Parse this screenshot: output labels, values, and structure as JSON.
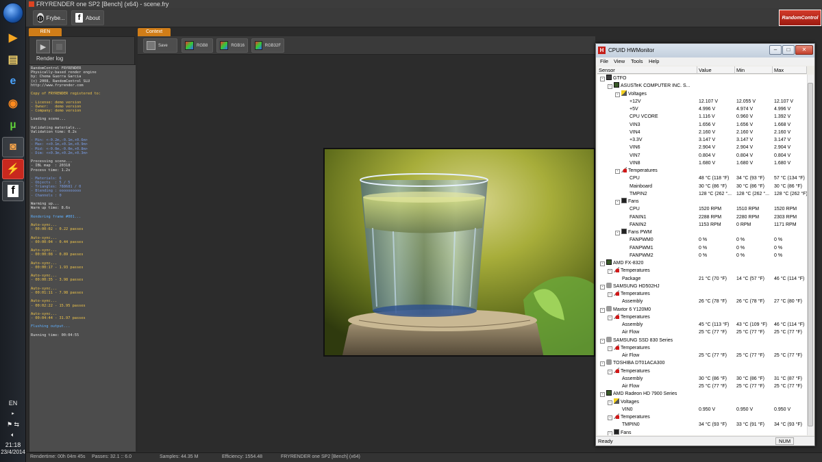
{
  "taskbar": {
    "language": "EN",
    "time": "21:18",
    "date": "23/4/2014"
  },
  "app": {
    "title": "FRYRENDER one SP2 [Bench] (x64) - scene.fry",
    "frybe_label": "Frybe...",
    "about_label": "About",
    "logo_text": "RandomControl",
    "ren_tab": "REN",
    "context_tab": "Context",
    "render_log_label": "Render log",
    "ctx_buttons": {
      "save": "Save",
      "rgb8": "RGB8",
      "rgb16": "RGB16",
      "rgb32f": "RGB32F"
    }
  },
  "log": [
    {
      "c": "lw",
      "t": "RandomControl FRYRENDER"
    },
    {
      "c": "lw",
      "t": "Physically-based render engine"
    },
    {
      "c": "lw",
      "t": "by: Chema Guerra Garcia"
    },
    {
      "c": "lw",
      "t": "(c) 2008, RandomControl SLU"
    },
    {
      "c": "lw",
      "t": "http://www.fryrender.com"
    },
    {
      "c": "lw",
      "t": ""
    },
    {
      "c": "ly",
      "t": "Copy of FRYRENDER registered to:"
    },
    {
      "c": "lw",
      "t": ""
    },
    {
      "c": "ly",
      "t": "- License: demo version"
    },
    {
      "c": "ly",
      "t": "- Owner:   demo version"
    },
    {
      "c": "ly",
      "t": "- Company: demo version"
    },
    {
      "c": "lw",
      "t": ""
    },
    {
      "c": "lw",
      "t": "Loading scene..."
    },
    {
      "c": "lw",
      "t": ""
    },
    {
      "c": "lw",
      "t": "Validating materials..."
    },
    {
      "c": "lw",
      "t": "Validation time: 0.2s"
    },
    {
      "c": "lw",
      "t": ""
    },
    {
      "c": "lb",
      "t": "- Min: <-0.2m,-0.1m,+0.6m>"
    },
    {
      "c": "lb",
      "t": "- Max: <+0.1m,+0.1m,+0.9m>"
    },
    {
      "c": "lb",
      "t": "- Mid: <-0.0m,-0.0m,+0.8m>"
    },
    {
      "c": "lb",
      "t": "- Dim: <+0.3m,+0.2m,+0.3m>"
    },
    {
      "c": "lw",
      "t": ""
    },
    {
      "c": "lw",
      "t": "Processing scene..."
    },
    {
      "c": "lw",
      "t": "- IBL map  : 20318"
    },
    {
      "c": "lw",
      "t": "Process time: 1.2s"
    },
    {
      "c": "lw",
      "t": ""
    },
    {
      "c": "lb",
      "t": "- Materials: 6"
    },
    {
      "c": "lb",
      "t": "- Objects  : 5 / 5"
    },
    {
      "c": "lb",
      "t": "- Triangles: 788681 / 0"
    },
    {
      "c": "lb",
      "t": "- Blending : oooooooooo"
    },
    {
      "c": "lb",
      "t": "- Channels : 0"
    },
    {
      "c": "lw",
      "t": ""
    },
    {
      "c": "lw",
      "t": "Warming up..."
    },
    {
      "c": "lw",
      "t": "Warm up time: 8.6s"
    },
    {
      "c": "lw",
      "t": ""
    },
    {
      "c": "lc",
      "t": "Rendering frame #001..."
    },
    {
      "c": "lw",
      "t": ""
    },
    {
      "c": "ly",
      "t": "Auto-sync..."
    },
    {
      "c": "ly",
      "t": "- 00:00:02 - 0.22 passes"
    },
    {
      "c": "lw",
      "t": ""
    },
    {
      "c": "ly",
      "t": "Auto-sync..."
    },
    {
      "c": "ly",
      "t": "- 00:00:04 - 0.44 passes"
    },
    {
      "c": "lw",
      "t": ""
    },
    {
      "c": "ly",
      "t": "Auto-sync..."
    },
    {
      "c": "ly",
      "t": "- 00:00:08 - 0.89 passes"
    },
    {
      "c": "lw",
      "t": ""
    },
    {
      "c": "ly",
      "t": "Auto-sync..."
    },
    {
      "c": "ly",
      "t": "- 00:00:17 - 1.93 passes"
    },
    {
      "c": "lw",
      "t": ""
    },
    {
      "c": "ly",
      "t": "Auto-sync..."
    },
    {
      "c": "ly",
      "t": "- 00:00:35 - 3.98 passes"
    },
    {
      "c": "lw",
      "t": ""
    },
    {
      "c": "ly",
      "t": "Auto-sync..."
    },
    {
      "c": "ly",
      "t": "- 00:01:11 - 7.98 passes"
    },
    {
      "c": "lw",
      "t": ""
    },
    {
      "c": "ly",
      "t": "Auto-sync..."
    },
    {
      "c": "ly",
      "t": "- 00:02:22 - 15.95 passes"
    },
    {
      "c": "lw",
      "t": ""
    },
    {
      "c": "ly",
      "t": "Auto-sync..."
    },
    {
      "c": "ly",
      "t": "- 00:04:44 - 31.97 passes"
    },
    {
      "c": "lw",
      "t": ""
    },
    {
      "c": "lc",
      "t": "Flushing output..."
    },
    {
      "c": "lw",
      "t": ""
    },
    {
      "c": "lw",
      "t": "Running time: 00:04:55"
    }
  ],
  "status": {
    "rendertime": "Rendertime:  00h 04m 45s",
    "passes": "Passes:  32.1 :: 6.0",
    "samples": "Samples:  44.35 M",
    "efficiency": "Efficiency:  1554.48",
    "product": "FRYRENDER one SP2 [Bench] (x64)"
  },
  "hwm": {
    "title": "CPUID HWMonitor",
    "menu": [
      "File",
      "View",
      "Tools",
      "Help"
    ],
    "columns": [
      "Sensor",
      "Value",
      "Min",
      "Max"
    ],
    "status_ready": "Ready",
    "status_num": "NUM",
    "rows": [
      {
        "lvl": 0,
        "icon": "ti-pc",
        "exp": "-",
        "n": "GTFO",
        "v": "",
        "mi": "",
        "ma": ""
      },
      {
        "lvl": 1,
        "icon": "ti-chip",
        "exp": "-",
        "n": "ASUSTeK COMPUTER INC. S...",
        "v": "",
        "mi": "",
        "ma": ""
      },
      {
        "lvl": 2,
        "icon": "ti-volt",
        "exp": "-",
        "n": "Voltages",
        "v": "",
        "mi": "",
        "ma": ""
      },
      {
        "lvl": 3,
        "n": "+12V",
        "v": "12.107 V",
        "mi": "12.055 V",
        "ma": "12.107 V"
      },
      {
        "lvl": 3,
        "n": "+5V",
        "v": "4.996 V",
        "mi": "4.974 V",
        "ma": "4.996 V"
      },
      {
        "lvl": 3,
        "n": "CPU VCORE",
        "v": "1.116 V",
        "mi": "0.960 V",
        "ma": "1.392 V"
      },
      {
        "lvl": 3,
        "n": "VIN3",
        "v": "1.656 V",
        "mi": "1.656 V",
        "ma": "1.668 V"
      },
      {
        "lvl": 3,
        "n": "VIN4",
        "v": "2.160 V",
        "mi": "2.160 V",
        "ma": "2.160 V"
      },
      {
        "lvl": 3,
        "n": "+3.3V",
        "v": "3.147 V",
        "mi": "3.147 V",
        "ma": "3.147 V"
      },
      {
        "lvl": 3,
        "n": "VIN6",
        "v": "2.904 V",
        "mi": "2.904 V",
        "ma": "2.904 V"
      },
      {
        "lvl": 3,
        "n": "VIN7",
        "v": "0.804 V",
        "mi": "0.804 V",
        "ma": "0.804 V"
      },
      {
        "lvl": 3,
        "n": "VIN8",
        "v": "1.680 V",
        "mi": "1.680 V",
        "ma": "1.680 V"
      },
      {
        "lvl": 2,
        "icon": "ti-temp",
        "exp": "-",
        "n": "Temperatures",
        "v": "",
        "mi": "",
        "ma": ""
      },
      {
        "lvl": 3,
        "n": "CPU",
        "v": "48 °C  (118 °F)",
        "mi": "34 °C  (93 °F)",
        "ma": "57 °C  (134 °F)"
      },
      {
        "lvl": 3,
        "n": "Mainboard",
        "v": "30 °C  (86 °F)",
        "mi": "30 °C  (86 °F)",
        "ma": "30 °C  (86 °F)"
      },
      {
        "lvl": 3,
        "n": "TMPIN2",
        "v": "128 °C  (262 °...",
        "mi": "128 °C  (262 °...",
        "ma": "128 °C  (262 °F)"
      },
      {
        "lvl": 2,
        "icon": "ti-fan",
        "exp": "-",
        "n": "Fans",
        "v": "",
        "mi": "",
        "ma": ""
      },
      {
        "lvl": 3,
        "n": "CPU",
        "v": "1520 RPM",
        "mi": "1510 RPM",
        "ma": "1520 RPM"
      },
      {
        "lvl": 3,
        "n": "FANIN1",
        "v": "2288 RPM",
        "mi": "2280 RPM",
        "ma": "2303 RPM"
      },
      {
        "lvl": 3,
        "n": "FANIN2",
        "v": "1153 RPM",
        "mi": "0 RPM",
        "ma": "1171 RPM"
      },
      {
        "lvl": 2,
        "icon": "ti-fan",
        "exp": "-",
        "n": "Fans PWM",
        "v": "",
        "mi": "",
        "ma": ""
      },
      {
        "lvl": 3,
        "n": "FANPWM0",
        "v": "0 %",
        "mi": "0 %",
        "ma": "0 %"
      },
      {
        "lvl": 3,
        "n": "FANPWM1",
        "v": "0 %",
        "mi": "0 %",
        "ma": "0 %"
      },
      {
        "lvl": 3,
        "n": "FANPWM2",
        "v": "0 %",
        "mi": "0 %",
        "ma": "0 %"
      },
      {
        "lvl": 0,
        "icon": "ti-chip",
        "exp": "-",
        "n": "AMD FX-8320",
        "v": "",
        "mi": "",
        "ma": ""
      },
      {
        "lvl": 1,
        "icon": "ti-temp",
        "exp": "-",
        "n": "Temperatures",
        "v": "",
        "mi": "",
        "ma": ""
      },
      {
        "lvl": 2,
        "n": "Package",
        "v": "21 °C  (70 °F)",
        "mi": "14 °C  (57 °F)",
        "ma": "46 °C  (114 °F)"
      },
      {
        "lvl": 0,
        "icon": "ti-hdd",
        "exp": "-",
        "n": "SAMSUNG HD502HJ",
        "v": "",
        "mi": "",
        "ma": ""
      },
      {
        "lvl": 1,
        "icon": "ti-temp",
        "exp": "-",
        "n": "Temperatures",
        "v": "",
        "mi": "",
        "ma": ""
      },
      {
        "lvl": 2,
        "n": "Assembly",
        "v": "26 °C  (78 °F)",
        "mi": "26 °C  (78 °F)",
        "ma": "27 °C  (80 °F)"
      },
      {
        "lvl": 0,
        "icon": "ti-hdd",
        "exp": "-",
        "n": "Maxtor 6 Y120M0",
        "v": "",
        "mi": "",
        "ma": ""
      },
      {
        "lvl": 1,
        "icon": "ti-temp",
        "exp": "-",
        "n": "Temperatures",
        "v": "",
        "mi": "",
        "ma": ""
      },
      {
        "lvl": 2,
        "n": "Assembly",
        "v": "45 °C  (113 °F)",
        "mi": "43 °C  (109 °F)",
        "ma": "46 °C  (114 °F)"
      },
      {
        "lvl": 2,
        "n": "Air Flow",
        "v": "25 °C  (77 °F)",
        "mi": "25 °C  (77 °F)",
        "ma": "25 °C  (77 °F)"
      },
      {
        "lvl": 0,
        "icon": "ti-hdd",
        "exp": "-",
        "n": "SAMSUNG SSD 830 Series",
        "v": "",
        "mi": "",
        "ma": ""
      },
      {
        "lvl": 1,
        "icon": "ti-temp",
        "exp": "-",
        "n": "Temperatures",
        "v": "",
        "mi": "",
        "ma": ""
      },
      {
        "lvl": 2,
        "n": "Air Flow",
        "v": "25 °C  (77 °F)",
        "mi": "25 °C  (77 °F)",
        "ma": "25 °C  (77 °F)"
      },
      {
        "lvl": 0,
        "icon": "ti-hdd",
        "exp": "-",
        "n": "TOSHIBA DT01ACA300",
        "v": "",
        "mi": "",
        "ma": ""
      },
      {
        "lvl": 1,
        "icon": "ti-temp",
        "exp": "-",
        "n": "Temperatures",
        "v": "",
        "mi": "",
        "ma": ""
      },
      {
        "lvl": 2,
        "n": "Assembly",
        "v": "30 °C  (86 °F)",
        "mi": "30 °C  (86 °F)",
        "ma": "31 °C  (87 °F)"
      },
      {
        "lvl": 2,
        "n": "Air Flow",
        "v": "25 °C  (77 °F)",
        "mi": "25 °C  (77 °F)",
        "ma": "25 °C  (77 °F)"
      },
      {
        "lvl": 0,
        "icon": "ti-chip",
        "exp": "-",
        "n": "AMD Radeon HD 7900 Series",
        "v": "",
        "mi": "",
        "ma": ""
      },
      {
        "lvl": 1,
        "icon": "ti-volt",
        "exp": "-",
        "n": "Voltages",
        "v": "",
        "mi": "",
        "ma": ""
      },
      {
        "lvl": 2,
        "n": "VIN0",
        "v": "0.950 V",
        "mi": "0.950 V",
        "ma": "0.950 V"
      },
      {
        "lvl": 1,
        "icon": "ti-temp",
        "exp": "-",
        "n": "Temperatures",
        "v": "",
        "mi": "",
        "ma": ""
      },
      {
        "lvl": 2,
        "n": "TMPIN0",
        "v": "34 °C  (93 °F)",
        "mi": "33 °C  (91 °F)",
        "ma": "34 °C  (93 °F)"
      },
      {
        "lvl": 1,
        "icon": "ti-fan",
        "exp": "-",
        "n": "Fans",
        "v": "",
        "mi": "",
        "ma": ""
      }
    ]
  }
}
